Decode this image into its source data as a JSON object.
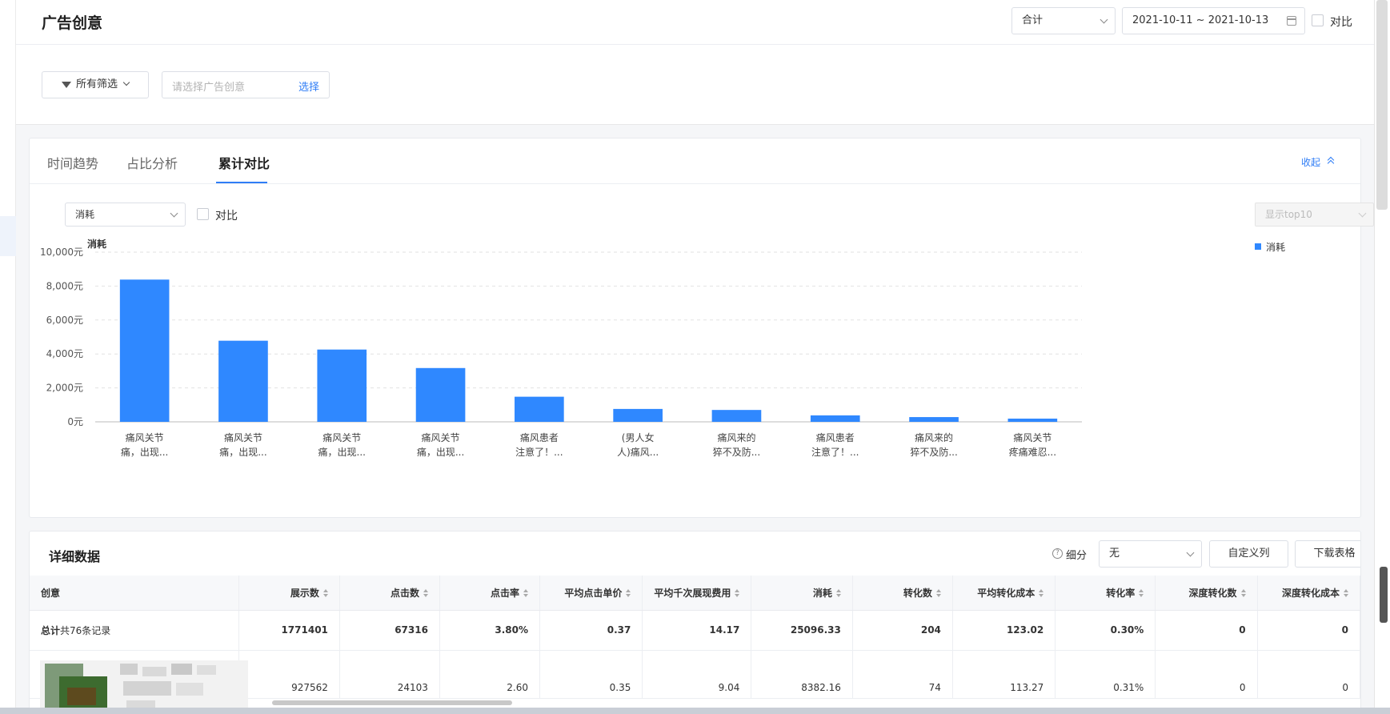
{
  "header": {
    "title": "广告创意",
    "aggregate_select": "合计",
    "date_range": "2021-10-11 ~ 2021-10-13",
    "compare_label": "对比"
  },
  "filters": {
    "all_filters_label": "所有筛选",
    "ad_placeholder": "请选择广告创意",
    "select_link": "选择"
  },
  "chart_card": {
    "tabs": [
      "时间趋势",
      "占比分析",
      "累计对比"
    ],
    "active_tab": "累计对比",
    "collapse_label": "收起",
    "metric_select": "消耗",
    "compare_label": "对比",
    "topn_select": "显示top10"
  },
  "chart_data": {
    "type": "bar",
    "ylabel": "消耗",
    "ylim": [
      0,
      10000
    ],
    "y_ticks": [
      "10,000元",
      "8,000元",
      "6,000元",
      "4,000元",
      "2,000元",
      "0元"
    ],
    "legend": [
      "消耗"
    ],
    "legend_position": "right",
    "grid": true,
    "color": "#2f88ff",
    "categories": [
      [
        "痛风关节",
        "痛，出现..."
      ],
      [
        "痛风关节",
        "痛，出现..."
      ],
      [
        "痛风关节",
        "痛，出现..."
      ],
      [
        "痛风关节",
        "痛，出现..."
      ],
      [
        "痛风患者",
        "注意了！..."
      ],
      [
        "(男人女",
        "人)痛风..."
      ],
      [
        "痛风来的",
        "猝不及防..."
      ],
      [
        "痛风患者",
        "注意了！..."
      ],
      [
        "痛风来的",
        "猝不及防..."
      ],
      [
        "痛风关节",
        "疼痛难忍..."
      ]
    ],
    "series": [
      {
        "name": "消耗",
        "values": [
          8382,
          4780,
          4260,
          3170,
          1480,
          760,
          700,
          380,
          280,
          190
        ]
      }
    ]
  },
  "table": {
    "title": "详细数据",
    "split_label": "细分",
    "split_select": "无",
    "custom_columns_button": "自定义列",
    "download_button": "下载表格",
    "columns": [
      "创意",
      "展示数",
      "点击数",
      "点击率",
      "平均点击单价",
      "平均千次展现费用",
      "消耗",
      "转化数",
      "平均转化成本",
      "转化率",
      "深度转化数",
      "深度转化成本"
    ],
    "total_row": {
      "label_bold": "总计",
      "label_rest": "共76条记录",
      "values": [
        "1771401",
        "67316",
        "3.80%",
        "0.37",
        "14.17",
        "25096.33",
        "204",
        "123.02",
        "0.30%",
        "0",
        "0"
      ]
    },
    "rows": [
      {
        "values": [
          "927562",
          "24103",
          "2.60",
          "0.35",
          "9.04",
          "8382.16",
          "74",
          "113.27",
          "0.31%",
          "0",
          "0"
        ]
      }
    ]
  }
}
